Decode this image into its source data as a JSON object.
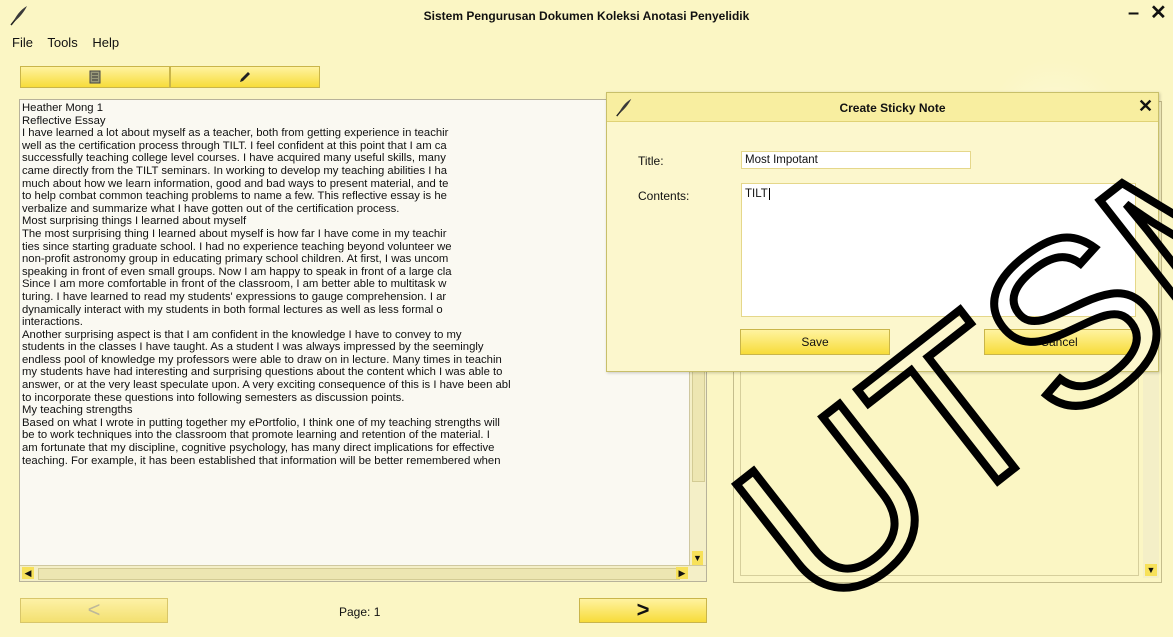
{
  "window": {
    "title": "Sistem Pengurusan Dokumen Koleksi Anotasi Penyelidik",
    "minimize": "–",
    "close": "✕"
  },
  "menu": {
    "items": [
      "File",
      "Tools",
      "Help"
    ]
  },
  "toolbar": {
    "buttons": [
      {
        "icon": "document-icon"
      },
      {
        "icon": "pencil-icon"
      }
    ]
  },
  "document": {
    "lines": [
      "Heather Mong 1",
      "Reflective Essay",
      "I have learned a lot about myself as a teacher, both from getting experience in teachir",
      "well as the certification process through TILT. I feel confident at this point that I am ca",
      "successfully teaching college level courses. I have acquired many useful skills, many",
      "came directly from the TILT seminars. In working to develop my teaching abilities I ha",
      "much about how we learn information, good and bad ways to present material, and te",
      "to help combat common teaching problems to name a few. This reflective essay is he",
      "verbalize and summarize what I have gotten out of the certification process.",
      "Most surprising things I learned about myself",
      "The most surprising thing I learned about myself is how far I have come in my teachir",
      "ties since starting graduate school. I had no experience teaching beyond volunteer we",
      "non-profit astronomy group in educating primary school children. At first, I was uncom",
      "speaking in front of even small groups. Now I am happy to speak in front of a large cla",
      "Since I am more comfortable in front of the classroom, I am better able to multitask w",
      "turing. I have learned to read my students' expressions to gauge comprehension. I ar",
      "dynamically interact with my students in both formal lectures as well as less formal o",
      "interactions.",
      "Another surprising aspect is that I am confident in the knowledge I have to convey to my",
      "students in the classes I have taught. As a student I was always impressed by the seemingly",
      "endless pool of knowledge my professors were able to draw on in lecture. Many times in teachin",
      "my students have had interesting and surprising questions about the content which I was able to",
      "answer, or at the very least speculate upon. A very exciting consequence of this is I have been abl",
      "to incorporate these questions into following semesters as discussion points.",
      "My teaching strengths",
      "Based on what I wrote in putting together my ePortfolio, I think one of my teaching strengths will",
      "be to work techniques into the classroom that promote learning and retention of the material. I",
      "am fortunate that my discipline, cognitive psychology, has many direct implications for effective",
      "teaching. For example, it has been established that information will be better remembered when"
    ]
  },
  "navigation": {
    "prev": "<",
    "page_label": "Page: 1",
    "next": ">"
  },
  "dialog": {
    "title": "Create Sticky Note",
    "close": "✕",
    "title_label": "Title:",
    "title_value": "Most Impotant",
    "contents_label": "Contents:",
    "contents_value": "TILT",
    "save_label": "Save",
    "cancel_label": "Cancel"
  },
  "watermark": {
    "text": "UTSM"
  },
  "colors": {
    "background": "#fbf6c4",
    "button_gradient_top": "#fff3a0",
    "button_gradient_bottom": "#f7dc3a",
    "border": "#c9b54a"
  }
}
